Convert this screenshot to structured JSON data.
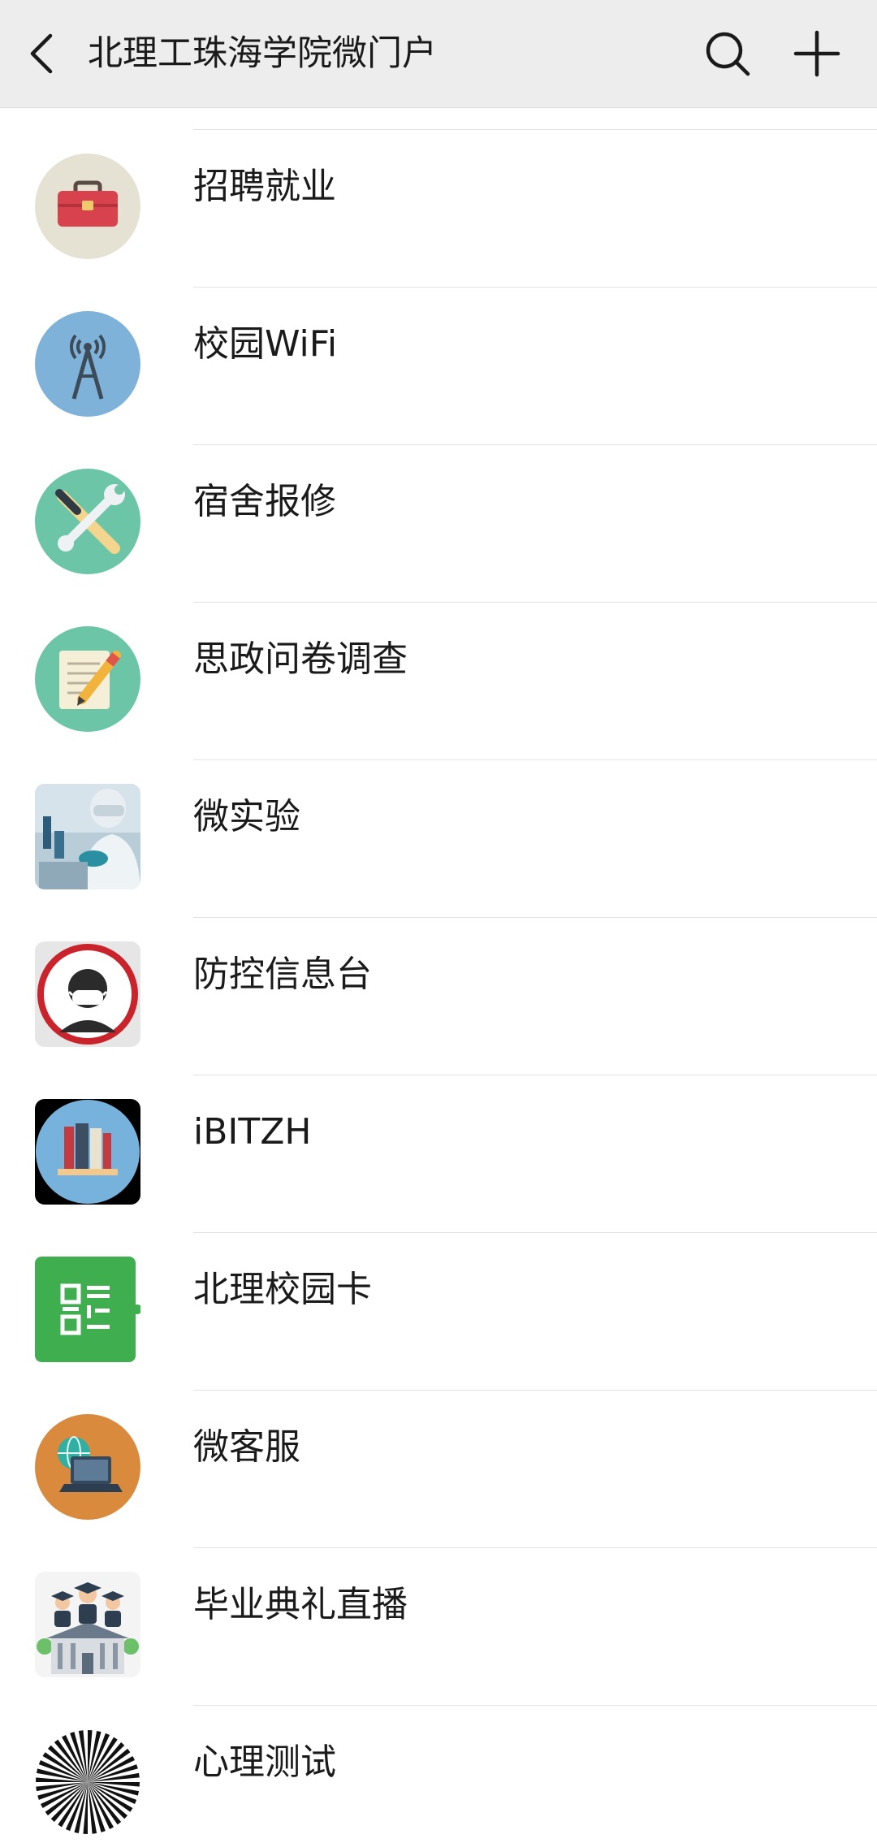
{
  "header": {
    "title": "北理工珠海学院微门户",
    "back_icon": "chevron-left-icon",
    "search_icon": "search-icon",
    "add_icon": "plus-icon"
  },
  "menu": {
    "items": [
      {
        "label": "招聘就业",
        "icon": "toolbox-icon"
      },
      {
        "label": "校园WiFi",
        "icon": "antenna-tower-icon"
      },
      {
        "label": "宿舍报修",
        "icon": "wrench-screwdriver-icon"
      },
      {
        "label": "思政问卷调查",
        "icon": "notepad-pencil-icon"
      },
      {
        "label": "微实验",
        "icon": "lab-scientist-icon"
      },
      {
        "label": "防控信息台",
        "icon": "masked-person-icon"
      },
      {
        "label": "iBITZH",
        "icon": "bookshelf-icon"
      },
      {
        "label": "北理校园卡",
        "icon": "qr-card-icon"
      },
      {
        "label": "微客服",
        "icon": "laptop-globe-icon"
      },
      {
        "label": "毕业典礼直播",
        "icon": "graduates-building-icon"
      },
      {
        "label": "心理测试",
        "icon": "radial-pattern-icon"
      }
    ]
  }
}
